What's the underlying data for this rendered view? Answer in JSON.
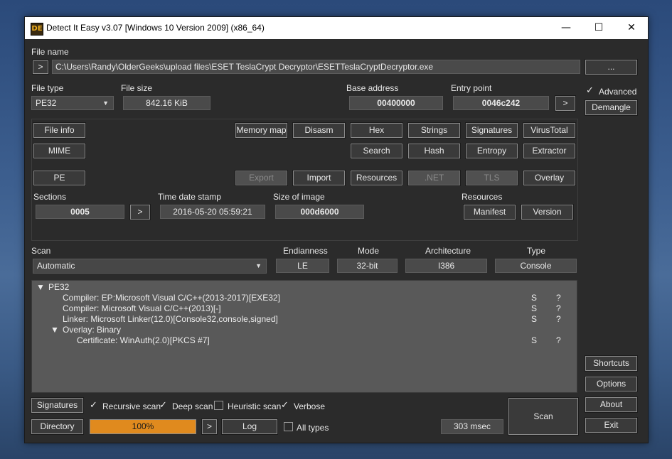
{
  "window": {
    "title": "Detect It Easy v3.07 [Windows 10 Version 2009] (x86_64)",
    "logo_text": "DE"
  },
  "file": {
    "label": "File name",
    "path": "C:\\Users\\Randy\\OlderGeeks\\upload files\\ESET TeslaCrypt Decryptor\\ESETTeslaCryptDecryptor.exe",
    "browse_label": "...",
    "nav_label": ">"
  },
  "info": {
    "file_type_label": "File type",
    "file_type": "PE32",
    "file_size_label": "File size",
    "file_size": "842.16 KiB",
    "base_address_label": "Base address",
    "base_address": "00400000",
    "entry_point_label": "Entry point",
    "entry_point": "0046c242",
    "entry_nav": ">"
  },
  "advanced": {
    "label": "Advanced",
    "checked": true,
    "demangle": "Demangle"
  },
  "buttons_row1": [
    "File info",
    "Memory map",
    "Disasm",
    "Hex",
    "Strings",
    "Signatures",
    "VirusTotal"
  ],
  "buttons_row2": [
    "MIME",
    "Search",
    "Hash",
    "Entropy",
    "Extractor"
  ],
  "pe": {
    "pe_button": "PE",
    "export": "Export",
    "import": "Import",
    "resources": "Resources",
    "net": ".NET",
    "tls": "TLS",
    "overlay": "Overlay",
    "sections_label": "Sections",
    "sections": "0005",
    "sections_nav": ">",
    "time_label": "Time date stamp",
    "time": "2016-05-20 05:59:21",
    "size_label": "Size of image",
    "size": "000d6000",
    "resources_label": "Resources",
    "manifest": "Manifest",
    "version": "Version"
  },
  "scan": {
    "label": "Scan",
    "mode_value": "Automatic",
    "endianness_label": "Endianness",
    "endianness": "LE",
    "mode_label": "Mode",
    "mode": "32-bit",
    "arch_label": "Architecture",
    "arch": "I386",
    "type_label": "Type",
    "type": "Console"
  },
  "results": [
    {
      "text": "PE32",
      "expander": "▼",
      "s": "",
      "q": ""
    },
    {
      "text": "Compiler: EP:Microsoft Visual C/C++(2013-2017)[EXE32]",
      "expander": "",
      "s": "S",
      "q": "?"
    },
    {
      "text": "Compiler: Microsoft Visual C/C++(2013)[-]",
      "expander": "",
      "s": "S",
      "q": "?"
    },
    {
      "text": "Linker: Microsoft Linker(12.0)[Console32,console,signed]",
      "expander": "",
      "s": "S",
      "q": "?"
    },
    {
      "text": "Overlay: Binary",
      "expander": "▼",
      "s": "",
      "q": ""
    },
    {
      "text": "Certificate: WinAuth(2.0)[PKCS #7]",
      "expander": "",
      "s": "S",
      "q": "?"
    }
  ],
  "side": {
    "shortcuts": "Shortcuts",
    "options": "Options",
    "about": "About",
    "exit": "Exit"
  },
  "bottom": {
    "signatures": "Signatures",
    "recursive": "Recursive scan",
    "deep": "Deep scan",
    "heuristic": "Heuristic scan",
    "verbose": "Verbose",
    "directory": "Directory",
    "progress": 100,
    "progress_text": "100%",
    "nav": ">",
    "log": "Log",
    "all_types": "All types",
    "time": "303 msec",
    "scan": "Scan"
  },
  "colors": {
    "accent": "#e08a1e",
    "background": "#2b2b2b"
  }
}
